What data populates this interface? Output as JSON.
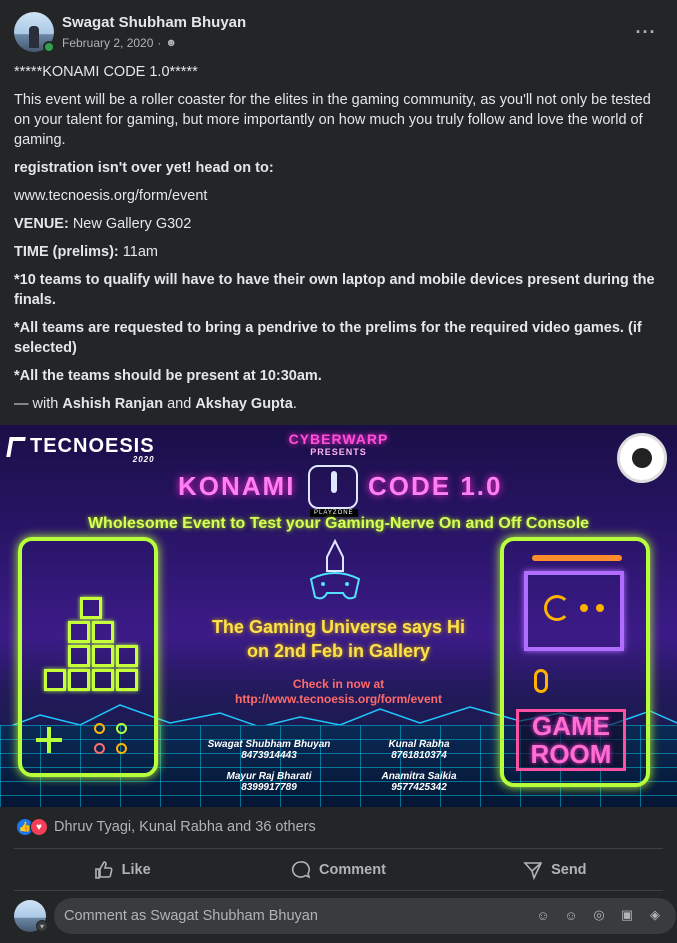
{
  "post": {
    "author": "Swagat Shubham Bhuyan",
    "date": "February 2, 2020",
    "privacy_icon": "friends-icon",
    "more_icon": "more-options-icon"
  },
  "body": {
    "title": "*****KONAMI CODE 1.0*****",
    "intro": "This event will be a roller coaster for the elites in the gaming community, as you'll not only be tested on your talent for gaming, but more importantly on how much you truly follow and love the world of gaming.",
    "registration": "registration isn't over yet! head on to:",
    "link": "www.tecnoesis.org/form/event",
    "venue_label": "VENUE:",
    "venue_value": " New Gallery G302",
    "time_label": "TIME (prelims):",
    "time_value": " 11am",
    "note1": "*10 teams to qualify will have to have their own laptop and mobile devices present during the finals.",
    "note2": "*All teams are requested to bring a pendrive to the prelims for the required video games. (if selected)",
    "note3": "*All the teams should be present at 10:30am.",
    "with_prefix": "— with ",
    "tag1": "Ashish Ranjan",
    "and": " and ",
    "tag2": "Akshay Gupta",
    "period": "."
  },
  "poster": {
    "logo": "TECNOESIS",
    "logo_year": "2020",
    "org": "CYBERWARP",
    "presents": "PRESENTS",
    "title_left": "KONAMI",
    "title_right": "CODE 1.0",
    "playzone": "PLAYZONE",
    "tagline": "Wholesome Event to Test your Gaming-Nerve On and Off Console",
    "universe": "The Gaming Universe says Hi",
    "date_line": "on 2nd Feb in Gallery",
    "check_in": "Check in now  at",
    "url": "http://www.tecnoesis.org/form/event",
    "game_room": "GAME ROOM",
    "contacts": [
      {
        "name": "Swagat Shubham Bhuyan",
        "phone": "8473914443"
      },
      {
        "name": "Kunal Rabha",
        "phone": "8761810374"
      },
      {
        "name": "Mayur Raj Bharati",
        "phone": "8399917789"
      },
      {
        "name": "Anamitra Saikia",
        "phone": "9577425342"
      }
    ]
  },
  "reactions": {
    "text": "Dhruv Tyagi, Kunal Rabha and 36 others"
  },
  "actions": {
    "like": "Like",
    "comment": "Comment",
    "send": "Send"
  },
  "comment_box": {
    "placeholder": "Comment as Swagat Shubham Bhuyan"
  },
  "colors": {
    "background": "#242526",
    "accent_like": "#1877f2",
    "accent_love": "#f33e58",
    "text_primary": "#e4e6eb",
    "text_secondary": "#b0b3b8"
  }
}
